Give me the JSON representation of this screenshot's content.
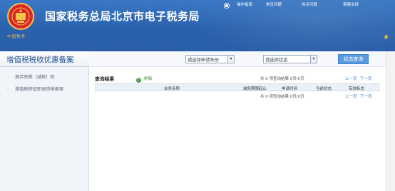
{
  "header": {
    "site_title": "国家税务总局北京市电子税务局",
    "emblem_caption": "中国税务",
    "top_links": [
      "操作指南",
      "常见问题",
      "热点问题",
      "客服支持"
    ]
  },
  "sidebar": {
    "title": "增值税税收优惠备案",
    "items": [
      {
        "label": "放弃免税（减税）权"
      },
      {
        "label": "增值税即征即退资格备案"
      }
    ]
  },
  "filters": {
    "year_select": "请选择申请年份",
    "status_select": "请选择状态",
    "query_button": "状态查询"
  },
  "results": {
    "title": "查询结果",
    "refresh_label": "刷新",
    "page_info": "共 0 项查询结果 0页/0页",
    "prev": "上一页",
    "next": "下一页",
    "columns": [
      "业务名称",
      "减免期限起止",
      "申请时间",
      "当前状态",
      "有效标志"
    ]
  },
  "colors": {
    "header_blue": "#2b62ad",
    "accent_blue": "#5a9be3",
    "link_blue": "#2e74c9",
    "title_blue": "#1f4f94"
  }
}
